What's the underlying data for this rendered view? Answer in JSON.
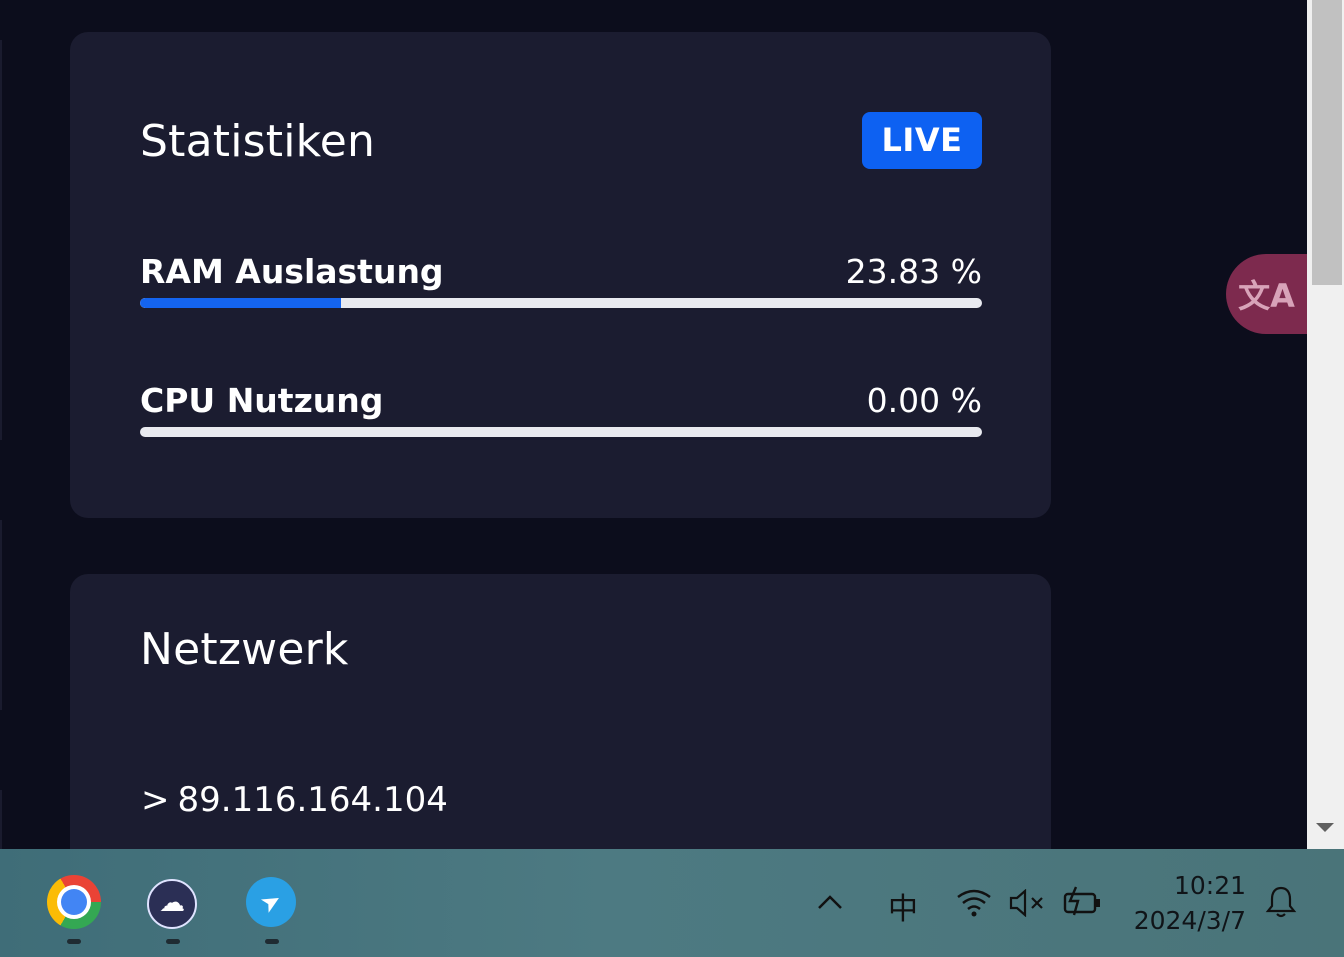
{
  "stats": {
    "title": "Statistiken",
    "live_label": "LIVE",
    "metrics": [
      {
        "label": "RAM Auslastung",
        "value": "23.83 %",
        "fraction": 0.2383
      },
      {
        "label": "CPU Nutzung",
        "value": "0.00 %",
        "fraction": 0.0
      }
    ]
  },
  "network": {
    "title": "Netzwerk",
    "ip_chevron": ">",
    "ip": "89.116.164.104"
  },
  "translate": {
    "icon": "translate-icon",
    "glyph": "文A"
  },
  "taskbar": {
    "apps": [
      {
        "name": "chrome-icon"
      },
      {
        "name": "cloud-app-icon"
      },
      {
        "name": "telegram-icon"
      }
    ],
    "tray": {
      "chevron": "^",
      "ime": "中",
      "wifi": "wifi-icon",
      "volume": "volume-muted-icon",
      "battery": "battery-charging-icon",
      "bell": "bell-icon"
    },
    "time": "10:21",
    "date": "2024/3/7"
  },
  "colors": {
    "background": "#0c0d1c",
    "card": "#1b1c30",
    "accent": "#0d61f2",
    "bar_track": "#e9eaf0"
  }
}
